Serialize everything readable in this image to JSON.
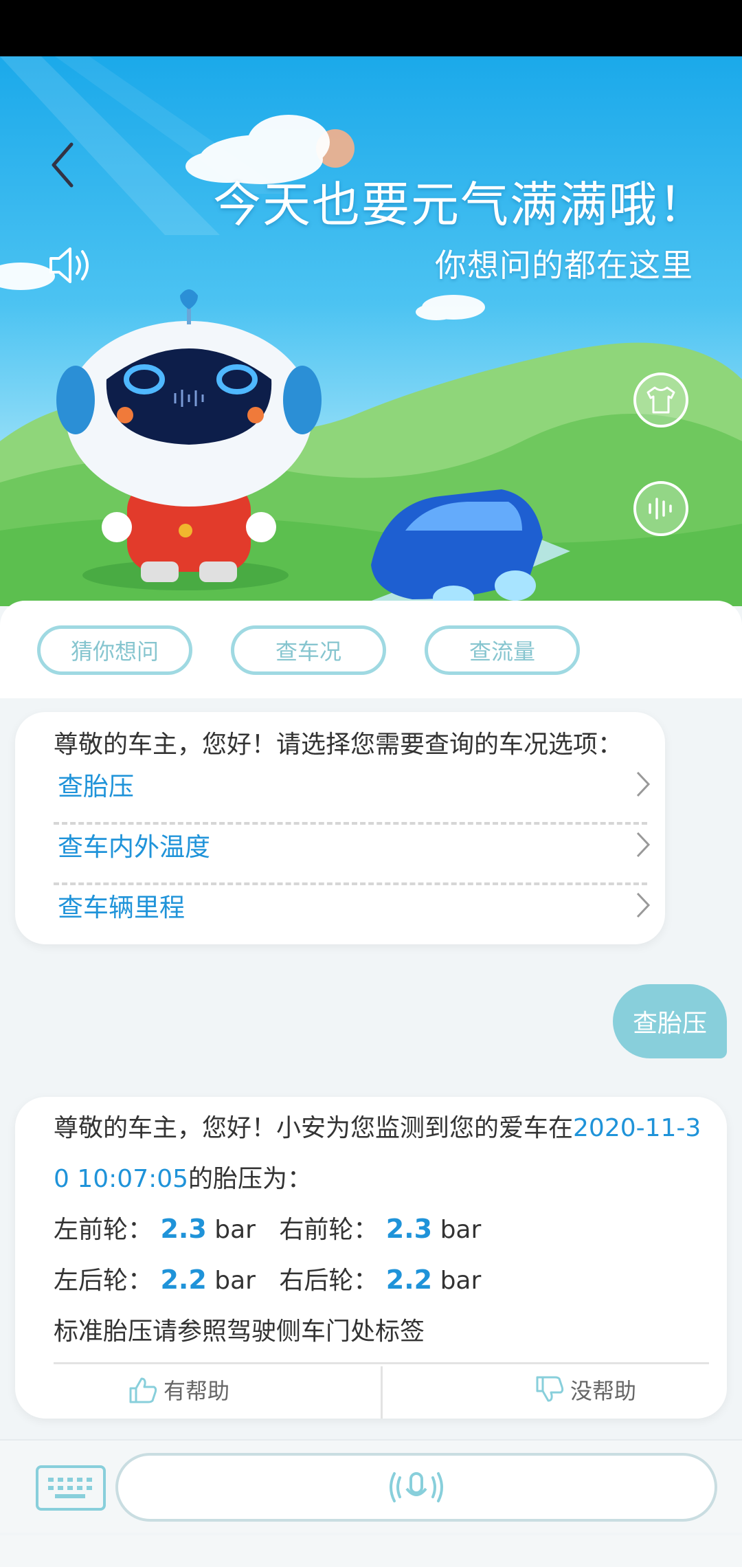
{
  "hero": {
    "title": "今天也要元气满满哦！",
    "subtitle": "你想问的都在这里",
    "icons": [
      "back-chevron-icon",
      "speaker-icon",
      "shirt-icon",
      "voice-wave-icon"
    ]
  },
  "quick_tabs": [
    "猜你想问",
    "查车况",
    "查流量"
  ],
  "chat": {
    "bot_menu": {
      "prompt": "尊敬的车主，您好！请选择您需要查询的车况选项：",
      "options": [
        "查胎压",
        "查车内外温度",
        "查车辆里程"
      ]
    },
    "user_message": "查胎压",
    "bot_reply": {
      "text_before_time": "尊敬的车主，您好！小安为您监测到您的爱车在",
      "time_line1": "2020-11-3",
      "time_line2": "0 10:07:05",
      "text_after_time": "的胎压为：",
      "front_left_label": "左前轮：",
      "front_left_value": "2.3",
      "front_right_label": "右前轮：",
      "front_right_value": "2.3",
      "rear_left_label": "左后轮：",
      "rear_left_value": "2.2",
      "rear_right_label": "右后轮：",
      "rear_right_value": "2.2",
      "unit": "bar",
      "note": "标准胎压请参照驾驶侧车门处标签"
    },
    "feedback": {
      "helpful": "有帮助",
      "not_helpful": "没帮助"
    }
  },
  "colors": {
    "accent_blue": "#1f93d9",
    "teal": "#88cfdb",
    "sky": "#1ba9ea"
  }
}
